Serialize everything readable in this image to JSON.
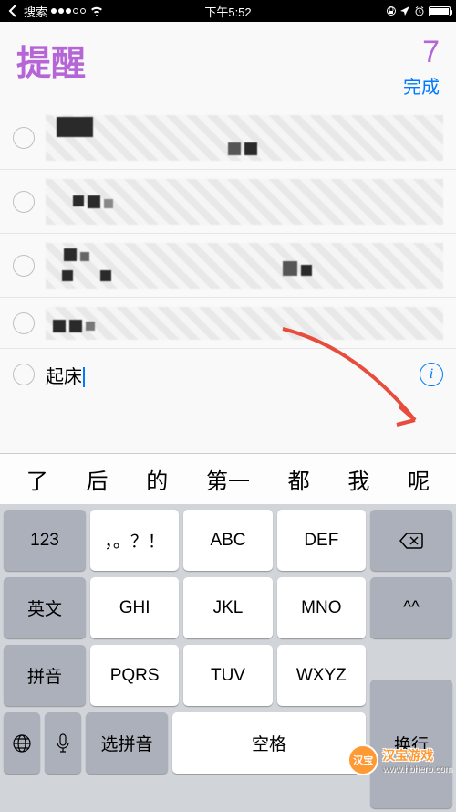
{
  "status": {
    "back": "搜索",
    "time": "下午5:52"
  },
  "header": {
    "title": "提醒",
    "count": "7",
    "done": "完成"
  },
  "items": [
    {
      "text": "",
      "blurred": true
    },
    {
      "text": "",
      "blurred": true
    },
    {
      "text": "",
      "blurred": true
    },
    {
      "text": "",
      "blurred": true
    },
    {
      "text": "起床",
      "blurred": false,
      "editing": true
    }
  ],
  "suggestions": [
    "了",
    "后",
    "的",
    "第一",
    "都",
    "我",
    "呢"
  ],
  "keys": {
    "r1": [
      "123",
      "，。？！",
      "ABC",
      "DEF"
    ],
    "r2": [
      "英文",
      "GHI",
      "JKL",
      "MNO",
      "^^"
    ],
    "r3": [
      "拼音",
      "PQRS",
      "TUV",
      "WXYZ"
    ],
    "r4": {
      "select": "选拼音",
      "space": "空格",
      "return": "换行"
    },
    "delete": "⌫"
  },
  "watermark": {
    "badge": "汉宝",
    "text": "汉宝游戏",
    "url": "www.hbherb.com"
  }
}
